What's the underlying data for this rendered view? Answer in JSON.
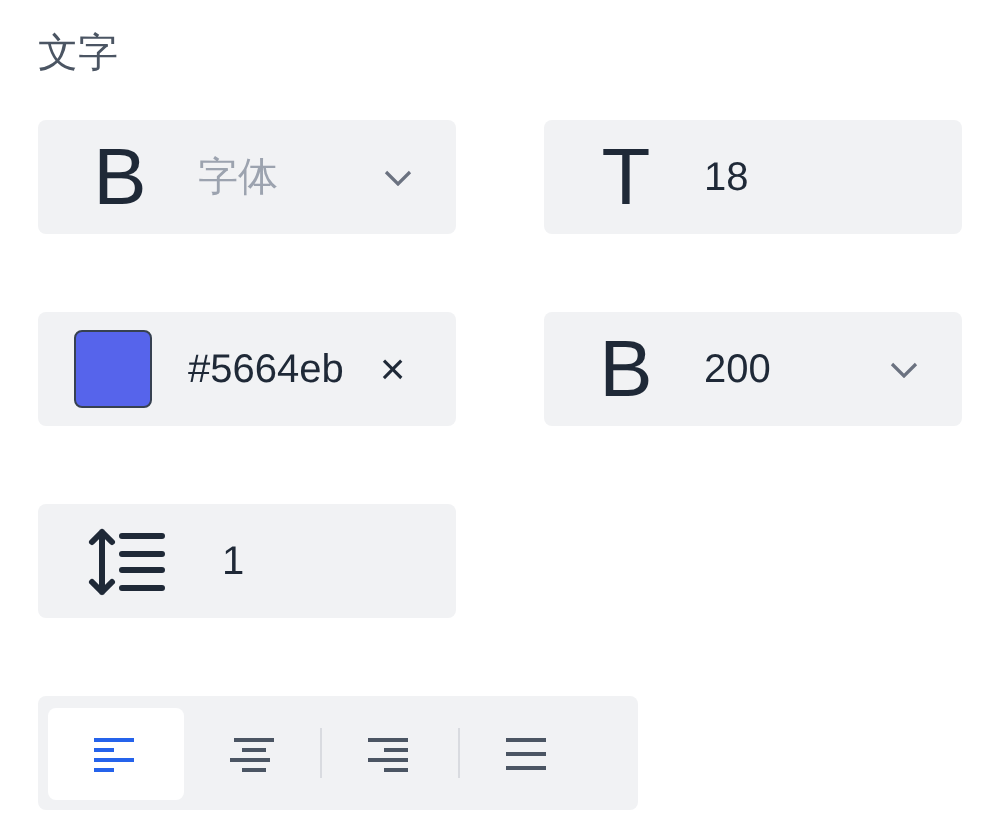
{
  "section_title": "文字",
  "fields": [
    {
      "kind": "select",
      "icon": "B",
      "placeholder": "字体"
    },
    {
      "kind": "input",
      "icon": "T",
      "value": "18"
    },
    {
      "kind": "color",
      "value": "#5664eb",
      "color": "#5664eb",
      "clear": "×"
    },
    {
      "kind": "select",
      "icon": "B",
      "value": "200"
    },
    {
      "kind": "lineheight",
      "value": "1"
    }
  ],
  "alignments": [
    {
      "kind": "left",
      "selected": true
    },
    {
      "kind": "center",
      "selected": false
    },
    {
      "kind": "right",
      "selected": false
    },
    {
      "kind": "justify",
      "selected": false
    }
  ]
}
